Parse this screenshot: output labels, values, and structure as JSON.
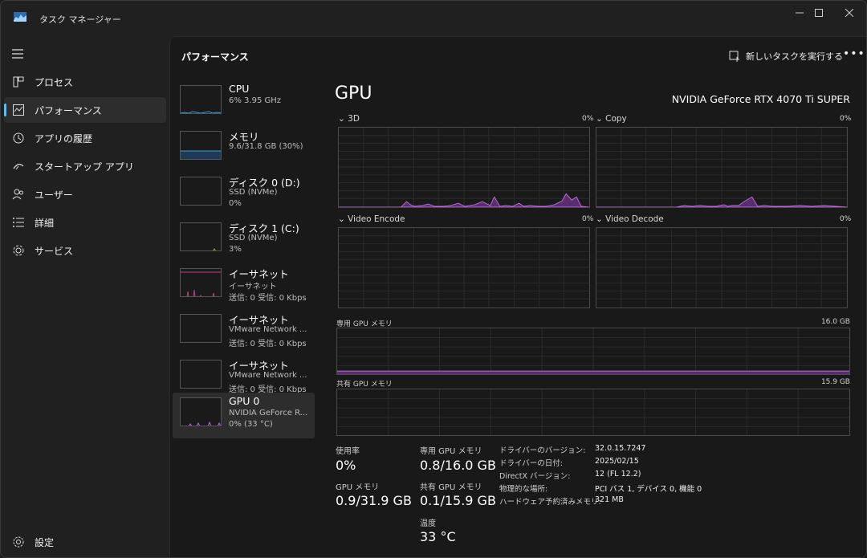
{
  "window": {
    "title": "タスク マネージャー",
    "controls": [
      "minimize-icon",
      "maximize-icon",
      "close-icon"
    ]
  },
  "nav": {
    "items": [
      {
        "label": "プロセス",
        "icon": "processes-icon"
      },
      {
        "label": "パフォーマンス",
        "icon": "performance-icon",
        "active": true
      },
      {
        "label": "アプリの履歴",
        "icon": "history-icon"
      },
      {
        "label": "スタートアップ アプリ",
        "icon": "startup-icon"
      },
      {
        "label": "ユーザー",
        "icon": "users-icon"
      },
      {
        "label": "詳細",
        "icon": "details-icon"
      },
      {
        "label": "サービス",
        "icon": "services-icon"
      }
    ],
    "settings_label": "設定"
  },
  "header": {
    "title": "パフォーマンス",
    "run_task_label": "新しいタスクを実行する",
    "more_label": "•••"
  },
  "devices": [
    {
      "name": "CPU",
      "sub1": "6%  3.95 GHz",
      "sub2": ""
    },
    {
      "name": "メモリ",
      "sub1": "9.6/31.8 GB (30%)",
      "sub2": ""
    },
    {
      "name": "ディスク 0 (D:)",
      "sub1": "SSD (NVMe)",
      "sub2": "0%"
    },
    {
      "name": "ディスク 1 (C:)",
      "sub1": "SSD (NVMe)",
      "sub2": "3%"
    },
    {
      "name": "イーサネット",
      "sub1": "イーサネット",
      "sub2": "送信: 0 受信: 0 Kbps"
    },
    {
      "name": "イーサネット",
      "sub1": "VMware Network ...",
      "sub2": "送信: 0 受信: 0 Kbps"
    },
    {
      "name": "イーサネット",
      "sub1": "VMware Network ...",
      "sub2": "送信: 0 受信: 0 Kbps"
    },
    {
      "name": "GPU 0",
      "sub1": "NVIDIA GeForce R...",
      "sub2": "0% (33 °C)",
      "active": true
    }
  ],
  "gpu": {
    "title": "GPU",
    "model": "NVIDIA GeForce RTX 4070 Ti SUPER",
    "engines": [
      {
        "label": "3D",
        "pct": "0%"
      },
      {
        "label": "Copy",
        "pct": "0%"
      },
      {
        "label": "Video Encode",
        "pct": "0%"
      },
      {
        "label": "Video Decode",
        "pct": "0%"
      }
    ],
    "dedicated_mem_label": "専用 GPU メモリ",
    "dedicated_mem_max": "16.0 GB",
    "shared_mem_label": "共有 GPU メモリ",
    "shared_mem_max": "15.9 GB",
    "stats": {
      "usage_label": "使用率",
      "usage_value": "0%",
      "gpu_mem_label": "GPU メモリ",
      "gpu_mem_value": "0.9/31.9 GB",
      "ded_label": "専用 GPU メモリ",
      "ded_value": "0.8/16.0 GB",
      "shared_label": "共有 GPU メモリ",
      "shared_value": "0.1/15.9 GB",
      "temp_label": "温度",
      "temp_value": "33 °C"
    },
    "info": [
      {
        "label": "ドライバーのバージョン:",
        "value": "32.0.15.7247"
      },
      {
        "label": "ドライバーの日付:",
        "value": "2025/02/15"
      },
      {
        "label": "DirectX バージョン:",
        "value": "12 (FL 12.2)"
      },
      {
        "label": "物理的な場所:",
        "value": "PCI バス 1, デバイス 0, 機能 0"
      },
      {
        "label": "ハードウェア予約済みメモリ:",
        "value": "321 MB"
      }
    ]
  },
  "colors": {
    "accent": "#4cc2ff",
    "gpu_line": "#b86ad6",
    "cpu_line": "#3aa0e0",
    "eth_line": "#c04080",
    "disk_line": "#7cb342"
  }
}
